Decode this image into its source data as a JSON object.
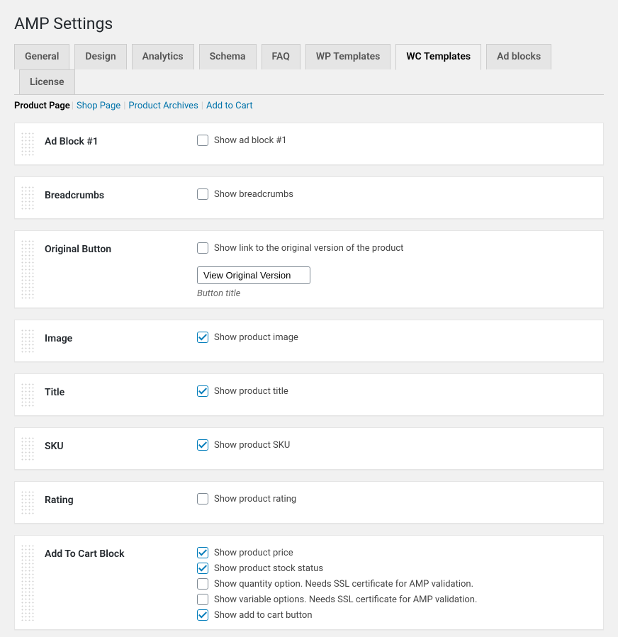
{
  "page_title": "AMP Settings",
  "tabs": [
    {
      "label": "General",
      "active": false
    },
    {
      "label": "Design",
      "active": false
    },
    {
      "label": "Analytics",
      "active": false
    },
    {
      "label": "Schema",
      "active": false
    },
    {
      "label": "FAQ",
      "active": false
    },
    {
      "label": "WP Templates",
      "active": false
    },
    {
      "label": "WC Templates",
      "active": true
    },
    {
      "label": "Ad blocks",
      "active": false
    },
    {
      "label": "License",
      "active": false
    }
  ],
  "subtabs": [
    {
      "label": "Product Page",
      "current": true
    },
    {
      "label": "Shop Page",
      "current": false
    },
    {
      "label": "Product Archives",
      "current": false
    },
    {
      "label": "Add to Cart",
      "current": false
    }
  ],
  "sections": {
    "ad_block": {
      "heading": "Ad Block #1",
      "checkbox_label": "Show ad block #1",
      "checked": false
    },
    "breadcrumbs": {
      "heading": "Breadcrumbs",
      "checkbox_label": "Show breadcrumbs",
      "checked": false
    },
    "original_button": {
      "heading": "Original Button",
      "checkbox_label": "Show link to the original version of the product",
      "checked": false,
      "input_value": "View Original Version",
      "description": "Button title"
    },
    "image": {
      "heading": "Image",
      "checkbox_label": "Show product image",
      "checked": true
    },
    "title": {
      "heading": "Title",
      "checkbox_label": "Show product title",
      "checked": true
    },
    "sku": {
      "heading": "SKU",
      "checkbox_label": "Show product SKU",
      "checked": true
    },
    "rating": {
      "heading": "Rating",
      "checkbox_label": "Show product rating",
      "checked": false
    },
    "add_to_cart": {
      "heading": "Add To Cart Block",
      "options": [
        {
          "label": "Show product price",
          "checked": true
        },
        {
          "label": "Show product stock status",
          "checked": true
        },
        {
          "label": "Show quantity option. Needs SSL certificate for AMP validation.",
          "checked": false
        },
        {
          "label": "Show variable options. Needs SSL certificate for AMP validation.",
          "checked": false
        },
        {
          "label": "Show add to cart button",
          "checked": true
        }
      ]
    }
  }
}
